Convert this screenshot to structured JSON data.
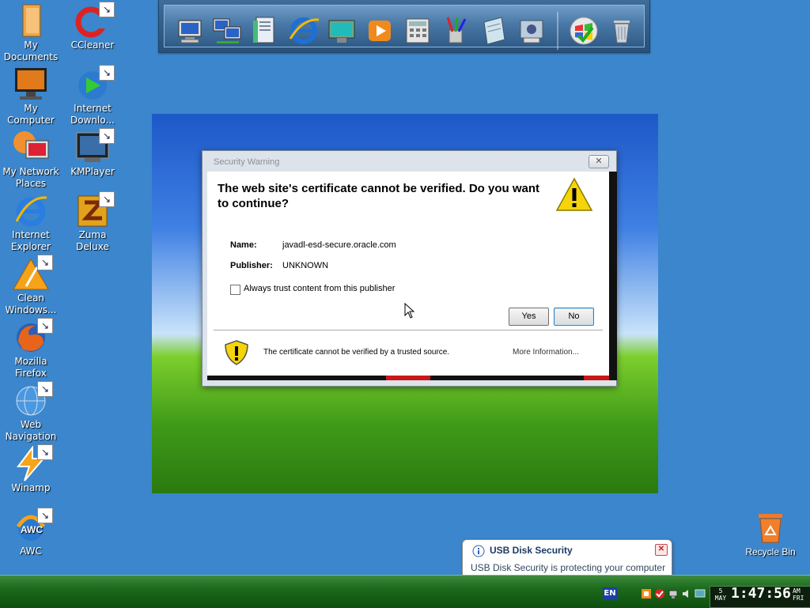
{
  "desktop_icons": [
    {
      "label": "My Documents",
      "icon": "folder-icon"
    },
    {
      "label": "CCleaner",
      "icon": "ccleaner-icon"
    },
    {
      "label": "My Computer",
      "icon": "computer-icon"
    },
    {
      "label": "Internet Downlo...",
      "icon": "download-manager-icon"
    },
    {
      "label": "My Network Places",
      "icon": "network-places-icon"
    },
    {
      "label": "KMPlayer",
      "icon": "kmplayer-icon"
    },
    {
      "label": "Internet Explorer",
      "icon": "internet-explorer-icon"
    },
    {
      "label": "Zuma Deluxe",
      "icon": "zuma-icon"
    },
    {
      "label": "Clean Windows...",
      "icon": "warning-broom-icon"
    },
    {
      "label": "Mozilla Firefox",
      "icon": "firefox-icon"
    },
    {
      "label": "Web Navigation",
      "icon": "globe-icon"
    },
    {
      "label": "Winamp",
      "icon": "winamp-icon"
    },
    {
      "label": "AWC",
      "icon": "awc-icon"
    }
  ],
  "recycle_bin": {
    "label": "Recycle Bin"
  },
  "dock": {
    "items": [
      "computer-icon",
      "network-icon",
      "documents-icon",
      "internet-explorer-icon",
      "monitor-icon",
      "media-player-icon",
      "calculator-icon",
      "paint-icon",
      "notepad-icon",
      "control-panel-icon",
      "windows-logo-icon",
      "recycle-bin-icon"
    ]
  },
  "dialog": {
    "title": "Security Warning",
    "close_label": "✕",
    "heading": "The web site's certificate cannot be verified. Do you want to continue?",
    "name_label": "Name:",
    "name_value": "javadl-esd-secure.oracle.com",
    "publisher_label": "Publisher:",
    "publisher_value": "UNKNOWN",
    "checkbox_label": "Always trust content from this publisher",
    "checkbox_checked": false,
    "yes_label": "Yes",
    "no_label": "No",
    "footer_text": "The certificate cannot be verified by a trusted source.",
    "more_info_label": "More Information..."
  },
  "balloon": {
    "title": "USB Disk Security",
    "text": "USB Disk Security is protecting your computer",
    "close_label": "✕"
  },
  "taskbar": {
    "language": "EN",
    "date_day": "5",
    "date_month": "MAY",
    "time": "1:47:56",
    "ampm": "AM",
    "weekday": "FRI"
  },
  "colors": {
    "desktop_bg": "#3b86cc",
    "taskbar_green": "#1c6a1c",
    "dialog_heading": "#000000"
  }
}
